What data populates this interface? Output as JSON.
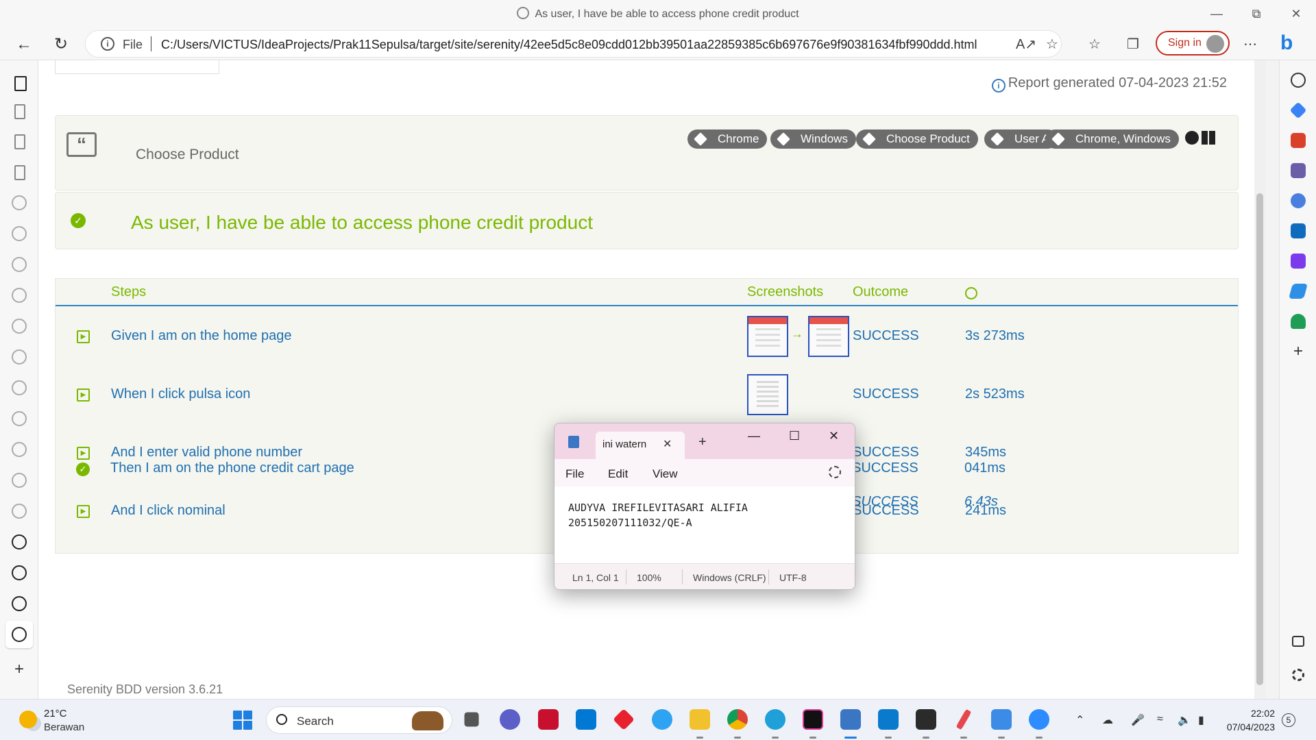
{
  "window": {
    "title": "As user, I have be able to access phone credit product"
  },
  "address_bar": {
    "scheme_label": "File",
    "url": "C:/Users/VICTUS/IdeaProjects/Prak11Sepulsa/target/site/serenity/42ee5d5c8e09cdd012bb39501aa22859385c6b697676e9f90381634fbf990ddd.html",
    "signin_label": "Sign in"
  },
  "report": {
    "generated": "Report generated 07-04-2023 21:52",
    "feature_name": "Choose Product",
    "tags": [
      "Chrome",
      "Windows",
      "Choose Product",
      "User A",
      "Chrome, Windows"
    ],
    "scenario_title": "As user, I have be able to access phone credit product",
    "headers": {
      "steps": "Steps",
      "screenshots": "Screenshots",
      "outcome": "Outcome"
    },
    "steps": [
      {
        "text": "Given I am on the home page",
        "outcome": "SUCCESS",
        "duration": "3s 273ms",
        "screenshots": [
          "red",
          "red"
        ]
      },
      {
        "text": "When I click pulsa icon",
        "outcome": "SUCCESS",
        "duration": "2s 523ms",
        "screenshots": [
          "gray"
        ]
      },
      {
        "text": "And I enter valid phone number",
        "outcome": "SUCCESS",
        "duration": "345ms",
        "screenshots": [
          "gray"
        ]
      },
      {
        "text": "And I click nominal",
        "outcome": "SUCCESS",
        "duration": "241ms",
        "screenshots": [
          "dark"
        ]
      },
      {
        "text": "Then I am on the phone credit cart page",
        "outcome": "SUCCESS",
        "duration": "041ms",
        "screenshots": [
          "dark"
        ]
      }
    ],
    "total": {
      "outcome": "SUCCESS",
      "duration": "6.43s"
    },
    "version": "Serenity BDD version 3.6.21"
  },
  "notepad": {
    "tab_title": "ini watern",
    "menu": [
      "File",
      "Edit",
      "View"
    ],
    "content": "AUDYVA IREFILEVITASARI ALIFIA\n205150207111032/QE-A",
    "status": {
      "position": "Ln 1, Col 1",
      "zoom": "100%",
      "line_ending": "Windows (CRLF)",
      "encoding": "UTF-8"
    }
  },
  "taskbar": {
    "weather_temp": "21°C",
    "weather_cond": "Berawan",
    "search_label": "Search",
    "time": "22:02",
    "date": "07/04/2023",
    "notification_count": "5"
  },
  "colors": {
    "success_green": "#7ab800",
    "step_blue": "#1f6fb0",
    "tag_gray": "#6c6c6c",
    "signin_red": "#c42b1c",
    "notepad_pink": "#f3d6e6"
  }
}
